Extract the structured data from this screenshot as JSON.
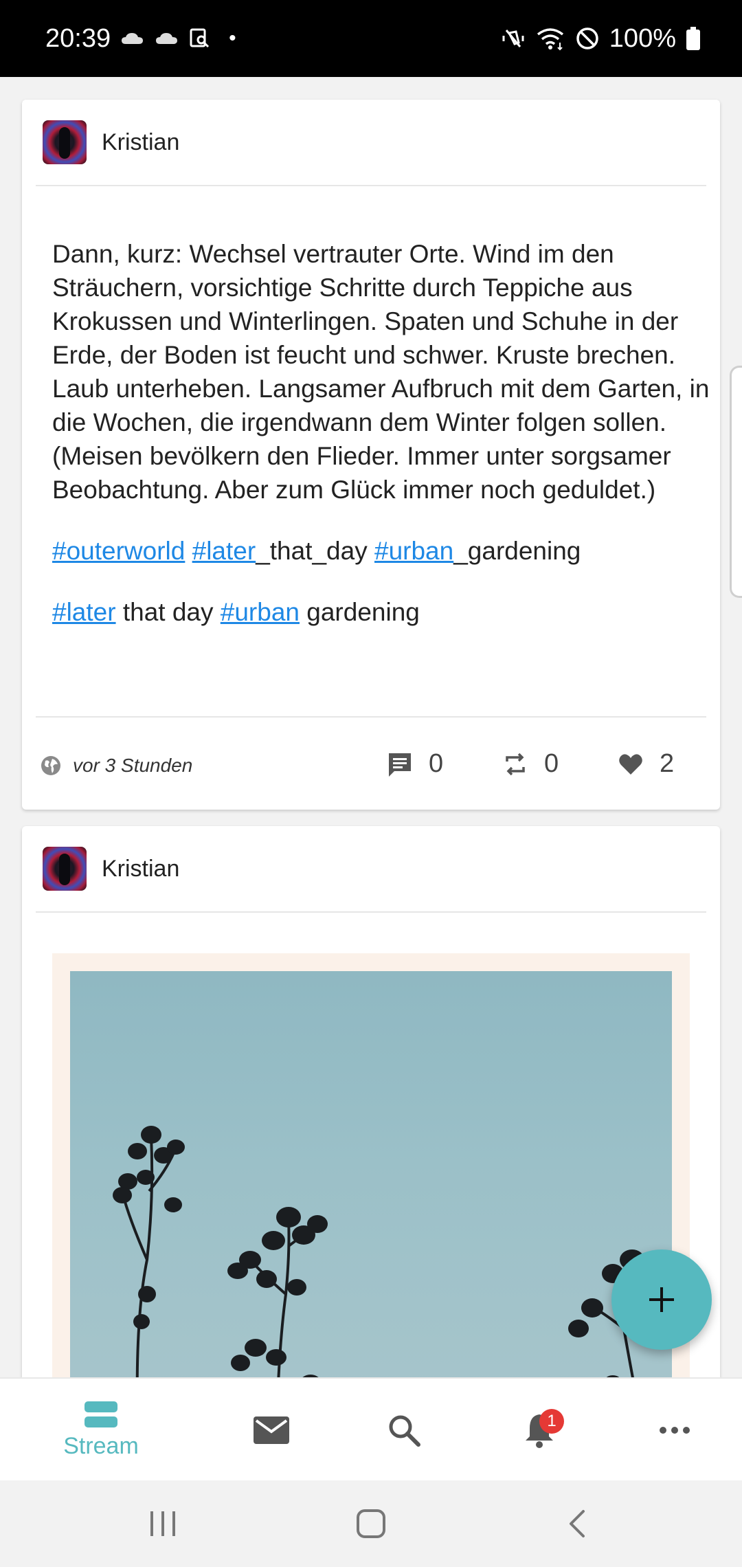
{
  "status_bar": {
    "time": "20:39",
    "battery": "100%",
    "dot": "•",
    "icons_left": [
      "cloud-icon",
      "cloud-icon",
      "screen-search-icon"
    ],
    "icons_right": [
      "vibrate-off-icon",
      "wifi-icon",
      "do-not-disturb-icon",
      "battery-icon"
    ]
  },
  "posts": [
    {
      "author": "Kristian",
      "body": "Dann, kurz: Wechsel vertrauter Orte. Wind im den Sträuchern, vorsichtige Schritte durch Teppiche aus Krokussen und Winterlingen. Spaten und Schuhe in der Erde, der Boden ist feucht und schwer. Kruste brechen. Laub unterheben. Langsamer Aufbruch mit dem Garten, in die Wochen, die irgendwann dem Winter folgen sollen. (Meisen bevölkern den Flieder. Immer unter sorgsamer Beobachtung. Aber zum Glück immer noch geduldet.)",
      "tags_line1": {
        "tag1": "#outerworld",
        "tag2": "#later",
        "text2": "_that_day",
        "tag3": "#urban",
        "text3": "_gardening"
      },
      "tags_line2": {
        "tag1": "#later",
        "text1": "that day",
        "tag2": "#urban",
        "text2": "gardening"
      },
      "timestamp": "vor 3 Stunden",
      "comments": "0",
      "reblogs": "0",
      "likes": "2"
    },
    {
      "author": "Kristian",
      "image": "photo of dried plant silhouettes against a pale blue sky"
    }
  ],
  "fab": {
    "icon": "plus-icon"
  },
  "bottom_nav": {
    "stream_label": "Stream",
    "notification_count": "1",
    "items": [
      "stream-icon",
      "mail-icon",
      "search-icon",
      "bell-icon",
      "more-icon"
    ]
  },
  "colors": {
    "accent": "#56b9bf",
    "link": "#1e88e5",
    "badge": "#e53935"
  }
}
